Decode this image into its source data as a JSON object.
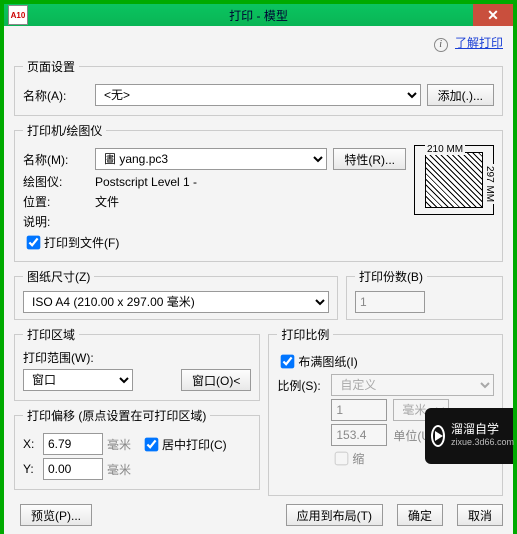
{
  "titlebar": {
    "icon_text": "A10",
    "title": "打印 - 模型",
    "close": "✕"
  },
  "toplink": {
    "info_label": "i",
    "link_text": "了解打印"
  },
  "page_setup": {
    "legend": "页面设置",
    "name_label": "名称(A):",
    "name_value": "<无>",
    "add_btn": "添加(.)..."
  },
  "printer": {
    "legend": "打印机/绘图仪",
    "name_label": "名称(M):",
    "name_value": "圕 yang.pc3",
    "props_btn": "特性(R)...",
    "plotter_label": "绘图仪:",
    "plotter_value": "Postscript Level 1 -",
    "location_label": "位置:",
    "location_value": "文件",
    "desc_label": "说明:",
    "desc_value": "",
    "print_to_file_label": "打印到文件(F)",
    "print_to_file_checked": true,
    "paper_w_label": "210 MM",
    "paper_h_label": "297 MM"
  },
  "papersize": {
    "legend": "图纸尺寸(Z)",
    "value": "ISO A4 (210.00 x 297.00 毫米)"
  },
  "copies": {
    "legend": "打印份数(B)",
    "value": "1"
  },
  "plotarea": {
    "legend": "打印区域",
    "range_label": "打印范围(W):",
    "range_value": "窗口",
    "window_btn": "窗口(O)<"
  },
  "scale": {
    "legend": "打印比例",
    "fit_label": "布满图纸(I)",
    "fit_checked": true,
    "ratio_label": "比例(S):",
    "ratio_value": "自定义",
    "num_value": "1",
    "unit1_value": "毫米",
    "denom_value": "153.4",
    "unit2_label": "单位(U)",
    "scale_lw_label": "缩"
  },
  "offset": {
    "legend": "打印偏移 (原点设置在可打印区域)",
    "x_label": "X:",
    "x_value": "6.79",
    "y_label": "Y:",
    "y_value": "0.00",
    "unit": "毫米",
    "center_label": "居中打印(C)",
    "center_checked": true
  },
  "footer": {
    "preview": "预览(P)...",
    "apply": "应用到布局(T)",
    "ok": "确定",
    "cancel": "取消"
  },
  "watermark": {
    "line1": "溜溜自学",
    "line2": "zixue.3d66.com"
  }
}
